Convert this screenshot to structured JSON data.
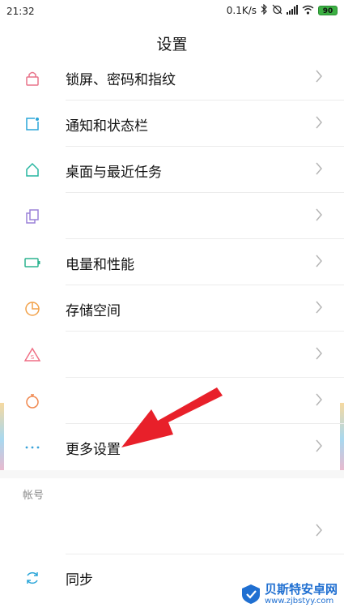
{
  "status_bar": {
    "time": "21:32",
    "net_speed": "0.1K/s",
    "battery_level": "90"
  },
  "header": {
    "title": "设置"
  },
  "settings": [
    {
      "label": "锁屏、密码和指纹",
      "icon": "lock-icon",
      "color": "#e8748a"
    },
    {
      "label": "通知和状态栏",
      "icon": "notification-icon",
      "color": "#2aa5d8"
    },
    {
      "label": "桌面与最近任务",
      "icon": "home-icon",
      "color": "#27b5a0"
    },
    {
      "label": "",
      "icon": "copy-icon",
      "color": "#9b82d8"
    },
    {
      "label": "电量和性能",
      "icon": "battery-icon",
      "color": "#2bb38f"
    },
    {
      "label": "存储空间",
      "icon": "pie-chart-icon",
      "color": "#f2a24b"
    },
    {
      "label": "",
      "icon": "security-icon",
      "color": "#ef6f85"
    },
    {
      "label": "",
      "icon": "timer-icon",
      "color": "#f0884f"
    },
    {
      "label": "更多设置",
      "icon": "more-icon",
      "color": "#3aa3d9"
    }
  ],
  "account_section": {
    "header": "帐号",
    "items": [
      {
        "label": "",
        "icon": "",
        "color": "#cccccc"
      },
      {
        "label": "同步",
        "icon": "sync-icon",
        "color": "#2aa5d8"
      }
    ]
  },
  "watermark": {
    "name": "贝斯特安卓网",
    "url": "www.zjbstyy.com"
  },
  "annotation": {
    "arrow_color": "#e8202a"
  }
}
